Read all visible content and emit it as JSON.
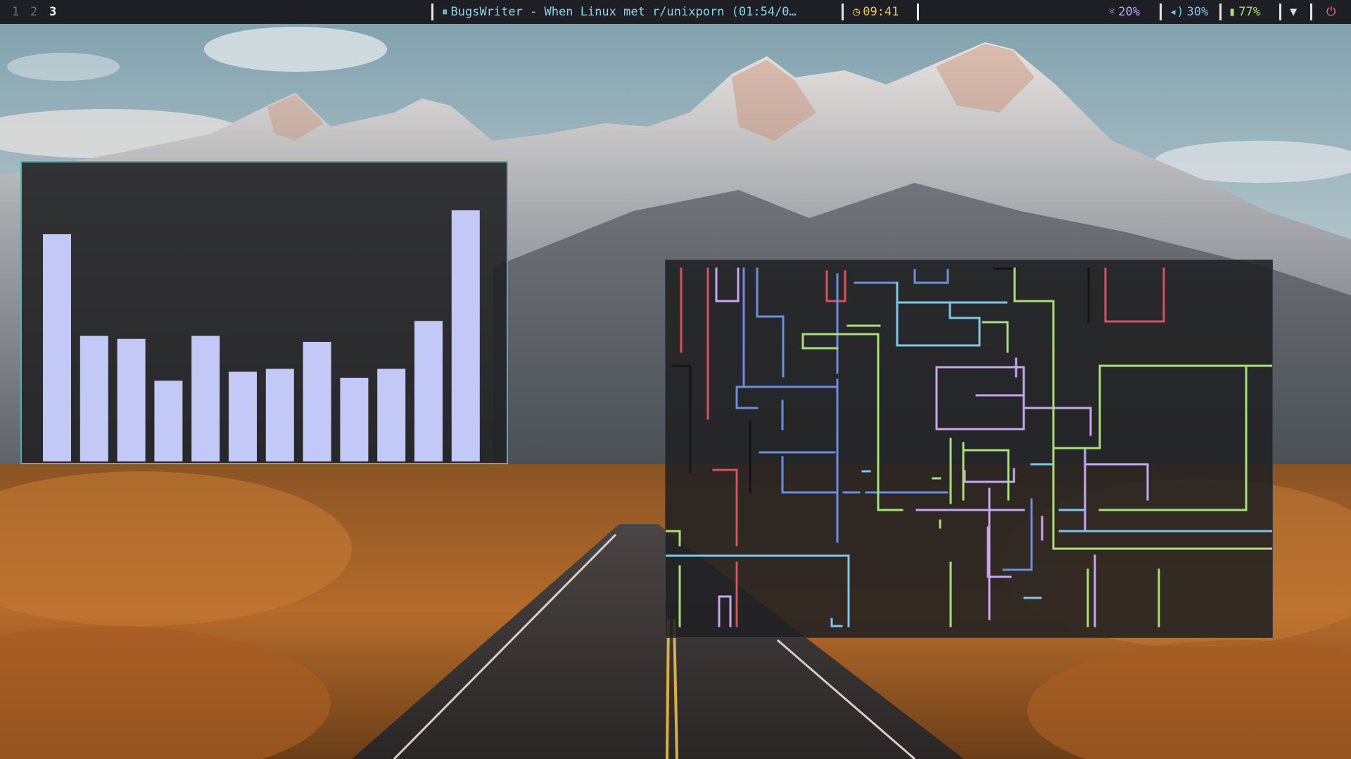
{
  "workspaces": [
    {
      "label": "1",
      "active": false
    },
    {
      "label": "2",
      "active": false
    },
    {
      "label": "3",
      "active": true
    }
  ],
  "now_playing": {
    "icon": "pause-icon",
    "title": "BugsWriter - When Linux met r/unixporn (01:54/0…"
  },
  "clock": {
    "icon": "clock-icon",
    "time": "09:41"
  },
  "status": {
    "brightness": {
      "icon": "sun-icon",
      "value": "20%"
    },
    "volume": {
      "icon": "speaker-icon",
      "value": "30%"
    },
    "battery": {
      "icon": "battery-icon",
      "value": "77%"
    },
    "wifi_icon": "wifi-icon",
    "power_icon": "power-icon"
  },
  "visualizer": {
    "bar_color": "#c3c9f6",
    "levels": [
      0.76,
      0.42,
      0.41,
      0.27,
      0.42,
      0.3,
      0.31,
      0.4,
      0.28,
      0.31,
      0.47,
      0.84
    ]
  },
  "colors": {
    "red": "#d9515e",
    "blue": "#6b8fe0",
    "cyan": "#7ec7e8",
    "green": "#a8e07a",
    "purple": "#c6a7f0",
    "dark": "#141416",
    "accent_border": "#3fb9ad"
  }
}
